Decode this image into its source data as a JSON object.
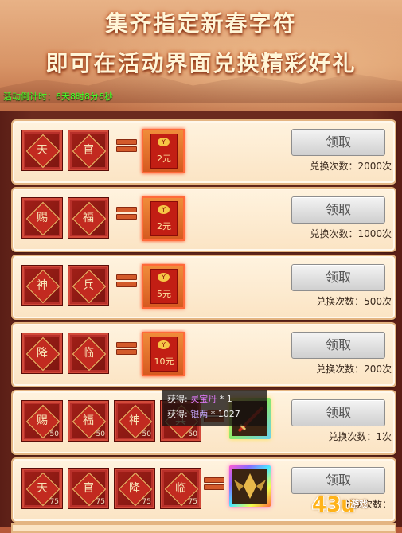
{
  "banner": {
    "line1": "集齐指定新春字符",
    "line2": "即可在活动界面兑换精彩好礼"
  },
  "countdown": "活动倒计时：6天8时8分6秒",
  "claim_label": "领取",
  "rows": [
    {
      "chars": [
        "天",
        "官"
      ],
      "counts": [
        "",
        ""
      ],
      "reward_amount": "2元",
      "coin": "Y",
      "times": "兑换次数：2000次"
    },
    {
      "chars": [
        "赐",
        "福"
      ],
      "counts": [
        "",
        ""
      ],
      "reward_amount": "2元",
      "coin": "Y",
      "times": "兑换次数：1000次"
    },
    {
      "chars": [
        "神",
        "兵"
      ],
      "counts": [
        "",
        ""
      ],
      "reward_amount": "5元",
      "coin": "Y",
      "times": "兑换次数：500次"
    },
    {
      "chars": [
        "降",
        "临"
      ],
      "counts": [
        "",
        ""
      ],
      "reward_amount": "10元",
      "coin": "Y",
      "times": "兑换次数：200次"
    },
    {
      "chars": [
        "赐",
        "福",
        "神",
        "兵"
      ],
      "counts": [
        "50",
        "50",
        "50",
        "50"
      ],
      "times": "兑换次数：1次"
    },
    {
      "chars": [
        "天",
        "官",
        "降",
        "临"
      ],
      "counts": [
        "75",
        "75",
        "75",
        "75"
      ],
      "times": "兑换次数："
    }
  ],
  "tooltip": {
    "line1_prefix": "获得: ",
    "line1_item": "灵宝丹",
    "line1_qty": " * 1",
    "line2_prefix": "获得: ",
    "line2_item": "银两",
    "line2_qty": " * 1027"
  },
  "watermark": {
    "main": "43u",
    "sub": "游戏"
  }
}
